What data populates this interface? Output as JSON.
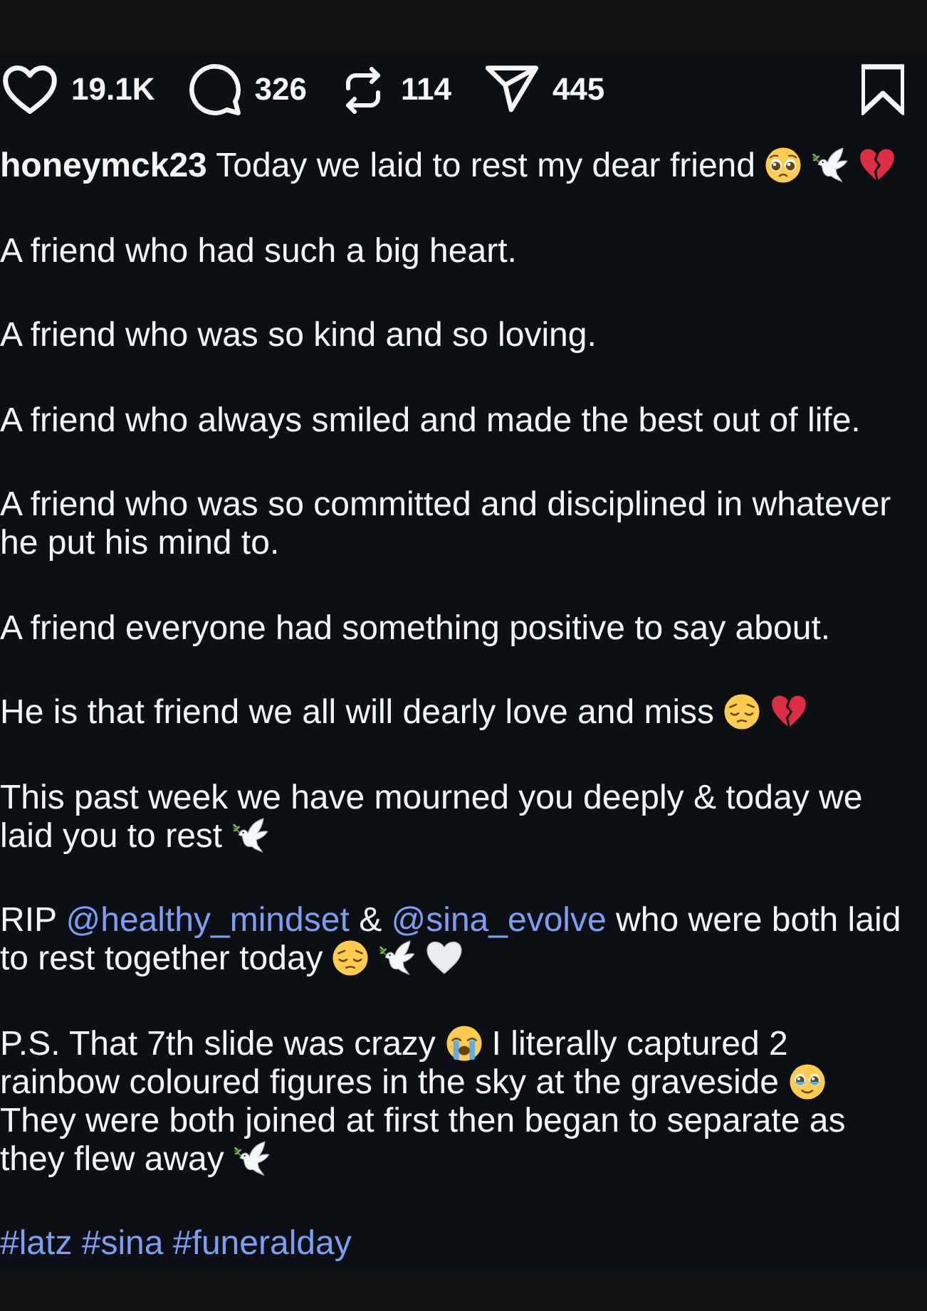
{
  "actions": [
    {
      "kind": "like",
      "count": "19.1K"
    },
    {
      "kind": "comment",
      "count": "326"
    },
    {
      "kind": "repost",
      "count": "114"
    },
    {
      "kind": "share",
      "count": "445"
    }
  ],
  "caption": {
    "paragraphs": [
      {
        "parts": [
          {
            "kind": "username",
            "text": "honeymck23"
          },
          {
            "kind": "text",
            "text": "Today we laid to rest my dear friend"
          },
          {
            "kind": "pleading-face"
          },
          {
            "kind": "dove"
          },
          {
            "kind": "broken-heart"
          }
        ]
      },
      {
        "parts": [
          {
            "kind": "text",
            "text": "A friend who had such a big heart."
          }
        ]
      },
      {
        "parts": [
          {
            "kind": "text",
            "text": "A friend who was so kind and so loving."
          }
        ]
      },
      {
        "parts": [
          {
            "kind": "text",
            "text": "A friend who always smiled and made the best out of life."
          }
        ]
      },
      {
        "parts": [
          {
            "kind": "text",
            "text": "A friend who was so committed and disciplined in whatever he put his mind to."
          }
        ]
      },
      {
        "parts": [
          {
            "kind": "text",
            "text": "A friend everyone had something positive to say about."
          }
        ]
      },
      {
        "parts": [
          {
            "kind": "text",
            "text": "He is that friend we all will dearly love and miss"
          },
          {
            "kind": "pensive-face"
          },
          {
            "kind": "broken-heart"
          }
        ]
      },
      {
        "parts": [
          {
            "kind": "text",
            "text": "This past week we have mourned you deeply & today we laid you to rest"
          },
          {
            "kind": "dove"
          }
        ]
      },
      {
        "parts": [
          {
            "kind": "text",
            "text": "RIP"
          },
          {
            "kind": "mention",
            "text": "@healthy_mindset"
          },
          {
            "kind": "text",
            "text": "&"
          },
          {
            "kind": "mention",
            "text": "@sina_evolve"
          },
          {
            "kind": "text",
            "text": "who were both laid to rest together today"
          },
          {
            "kind": "pensive-face"
          },
          {
            "kind": "dove"
          },
          {
            "kind": "white-heart"
          }
        ]
      },
      {
        "parts": [
          {
            "kind": "text",
            "text": "P.S. That 7th slide was crazy"
          },
          {
            "kind": "crying-face"
          },
          {
            "kind": "text",
            "text": "I literally captured 2 rainbow coloured figures in the sky at the graveside"
          },
          {
            "kind": "teary-smile"
          },
          {
            "kind": "text",
            "text": "They were both joined at first then began to separate as they flew away"
          },
          {
            "kind": "dove"
          }
        ]
      },
      {
        "parts": [
          {
            "kind": "hashtag",
            "text": "#latz"
          },
          {
            "kind": "hashtag",
            "text": "#sina"
          },
          {
            "kind": "hashtag",
            "text": "#funeralday"
          }
        ]
      }
    ]
  }
}
